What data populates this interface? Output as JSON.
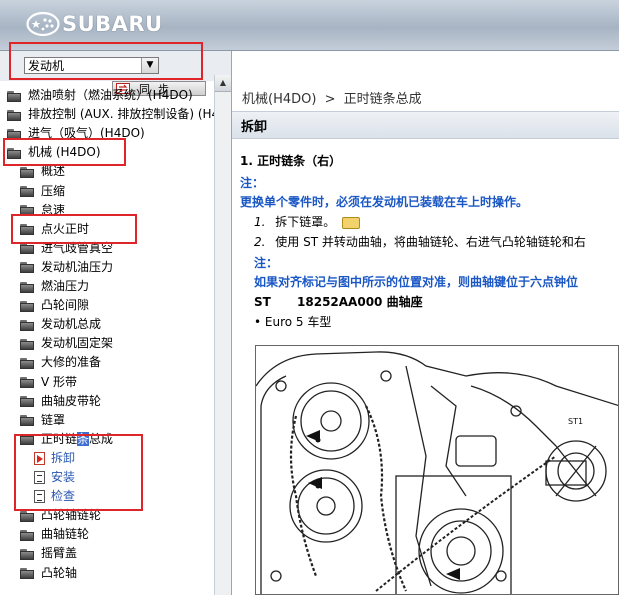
{
  "header": {
    "logo_text": "SUBARU"
  },
  "left_pane": {
    "dropdown": {
      "selected": "发动机"
    },
    "sync_button": {
      "label": "同步"
    },
    "tree": [
      {
        "label": "燃油喷射（燃油系统）(H4DO)",
        "icon": "folder-icon",
        "level": 0
      },
      {
        "label": "排放控制 (AUX. 排放控制设备) (H4",
        "icon": "folder-icon",
        "level": 0
      },
      {
        "label": "进气（吸气）(H4DO)",
        "icon": "folder-icon",
        "level": 0
      },
      {
        "label": "机械 (H4DO)",
        "icon": "folder-open-icon",
        "level": 0
      },
      {
        "label": "概述",
        "icon": "folder-icon",
        "level": 1
      },
      {
        "label": "压缩",
        "icon": "folder-icon",
        "level": 1
      },
      {
        "label": "怠速",
        "icon": "folder-icon",
        "level": 1
      },
      {
        "label": "点火正时",
        "icon": "folder-icon",
        "level": 1
      },
      {
        "label": "进气歧管真空",
        "icon": "folder-icon",
        "level": 1
      },
      {
        "label": "发动机油压力",
        "icon": "folder-icon",
        "level": 1
      },
      {
        "label": "燃油压力",
        "icon": "folder-icon",
        "level": 1
      },
      {
        "label": "凸轮间隙",
        "icon": "folder-icon",
        "level": 1
      },
      {
        "label": "发动机总成",
        "icon": "folder-icon",
        "level": 1
      },
      {
        "label": "发动机固定架",
        "icon": "folder-icon",
        "level": 1
      },
      {
        "label": "大修的准备",
        "icon": "folder-icon",
        "level": 1
      },
      {
        "label": "V 形带",
        "icon": "folder-icon",
        "level": 1
      },
      {
        "label": "曲轴皮带轮",
        "icon": "folder-icon",
        "level": 1
      },
      {
        "label": "链罩",
        "icon": "folder-icon",
        "level": 1
      },
      {
        "label_a": "正时链",
        "label_hl": "条",
        "label_b": "总成",
        "icon": "folder-open-icon",
        "level": 1
      },
      {
        "label": "拆卸",
        "icon": "doc-active-icon",
        "level": 2
      },
      {
        "label": "安装",
        "icon": "doc-icon",
        "level": 2
      },
      {
        "label": "检查",
        "icon": "doc-icon",
        "level": 2
      },
      {
        "label": "凸轮轴链轮",
        "icon": "folder-icon",
        "level": 1
      },
      {
        "label": "曲轴链轮",
        "icon": "folder-icon",
        "level": 1
      },
      {
        "label": "摇臂盖",
        "icon": "folder-icon",
        "level": 1
      },
      {
        "label": "凸轮轴",
        "icon": "folder-icon",
        "level": 1
      }
    ]
  },
  "content": {
    "breadcrumb": {
      "parent": "机械(H4DO)",
      "separator": ">",
      "current": "正时链条总成"
    },
    "section_title": "拆卸",
    "step_heading": "1.  正时链条（右）",
    "note1_label": "注：",
    "note1_text": "更换单个零件时，必须在发动机已装载在车上时操作。",
    "step1_num": "1.",
    "step1_text": "拆下链罩。",
    "step2_num": "2.",
    "step2_text": "使用 ST 并转动曲轴，将曲轴链轮、右进气凸轮轴链轮和右",
    "note2_label": "注：",
    "note2_text": "如果对齐标记与图中所示的位置对准，则曲轴键位于六点钟位",
    "st_label": "ST",
    "st_part": "18252AA000 曲轴座",
    "bullet_text": "• Euro 5 车型",
    "figure_label": "ST1"
  },
  "colors": {
    "annotation_red": "#e0252a",
    "note_blue": "#1a57c4",
    "tree_highlight": "#3d6fd1"
  }
}
